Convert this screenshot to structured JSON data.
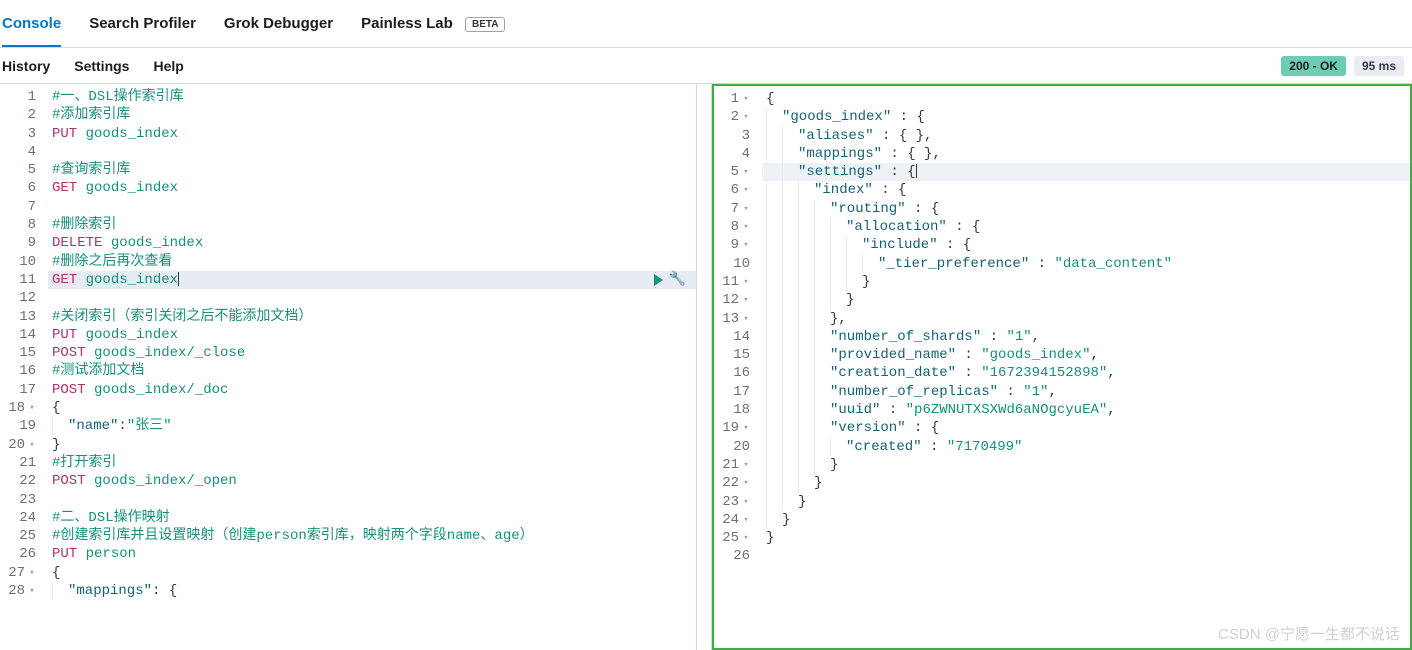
{
  "tabs": {
    "console": "Console",
    "profiler": "Search Profiler",
    "grok": "Grok Debugger",
    "painless": "Painless Lab",
    "beta": "BETA"
  },
  "menu": {
    "history": "History",
    "settings": "Settings",
    "help": "Help"
  },
  "status": {
    "ok": "200 - OK",
    "time": "95 ms"
  },
  "editor": {
    "lines": [
      {
        "n": 1,
        "type": "comment",
        "text": "#一、DSL操作索引库"
      },
      {
        "n": 2,
        "type": "comment",
        "text": "#添加索引库"
      },
      {
        "n": 3,
        "type": "req",
        "method": "PUT",
        "path": " goods_index"
      },
      {
        "n": 4,
        "type": "blank",
        "text": ""
      },
      {
        "n": 5,
        "type": "comment",
        "text": "#查询索引库"
      },
      {
        "n": 6,
        "type": "req",
        "method": "GET",
        "path": " goods_index"
      },
      {
        "n": 7,
        "type": "blank",
        "text": ""
      },
      {
        "n": 8,
        "type": "comment",
        "text": "#删除索引"
      },
      {
        "n": 9,
        "type": "req",
        "method": "DELETE",
        "path": " goods_index"
      },
      {
        "n": 10,
        "type": "comment",
        "text": "#删除之后再次查看"
      },
      {
        "n": 11,
        "type": "req",
        "method": "GET",
        "path": " goods_index",
        "hl": true,
        "actions": true,
        "cursor": true
      },
      {
        "n": 12,
        "type": "blank",
        "text": ""
      },
      {
        "n": 13,
        "type": "comment",
        "text": "#关闭索引（索引关闭之后不能添加文档）"
      },
      {
        "n": 14,
        "type": "req",
        "method": "PUT",
        "path": " goods_index"
      },
      {
        "n": 15,
        "type": "req",
        "method": "POST",
        "path": " goods_index/_close"
      },
      {
        "n": 16,
        "type": "comment",
        "text": "#测试添加文档"
      },
      {
        "n": 17,
        "type": "req",
        "method": "POST",
        "path": " goods_index/_doc"
      },
      {
        "n": 18,
        "type": "punct",
        "text": "{",
        "fold": true
      },
      {
        "n": 19,
        "type": "kv",
        "indent": 1,
        "key": "\"name\"",
        "sep": ":",
        "val": "\"张三\""
      },
      {
        "n": 20,
        "type": "punct",
        "text": "}",
        "fold": true
      },
      {
        "n": 21,
        "type": "comment",
        "text": "#打开索引"
      },
      {
        "n": 22,
        "type": "req",
        "method": "POST",
        "path": " goods_index/_open"
      },
      {
        "n": 23,
        "type": "blank",
        "text": ""
      },
      {
        "n": 24,
        "type": "comment",
        "text": "#二、DSL操作映射"
      },
      {
        "n": 25,
        "type": "comment",
        "text": "#创建索引库并且设置映射（创建person索引库，映射两个字段name、age）"
      },
      {
        "n": 26,
        "type": "req",
        "method": "PUT",
        "path": " person"
      },
      {
        "n": 27,
        "type": "punct",
        "text": "{",
        "fold": true
      },
      {
        "n": 28,
        "type": "kv",
        "indent": 1,
        "key": "\"mappings\"",
        "sep": ": ",
        "val": "{",
        "fold": true
      }
    ]
  },
  "response": {
    "lines": [
      {
        "n": 1,
        "fold": true,
        "ind": 0,
        "seg": [
          {
            "t": "{",
            "c": "punct"
          }
        ]
      },
      {
        "n": 2,
        "fold": true,
        "ind": 1,
        "seg": [
          {
            "t": "\"goods_index\"",
            "c": "key"
          },
          {
            "t": " : ",
            "c": "punct"
          },
          {
            "t": "{",
            "c": "punct"
          }
        ]
      },
      {
        "n": 3,
        "fold": false,
        "ind": 2,
        "seg": [
          {
            "t": "\"aliases\"",
            "c": "key"
          },
          {
            "t": " : ",
            "c": "punct"
          },
          {
            "t": "{ },",
            "c": "punct"
          }
        ]
      },
      {
        "n": 4,
        "fold": false,
        "ind": 2,
        "seg": [
          {
            "t": "\"mappings\"",
            "c": "key"
          },
          {
            "t": " : ",
            "c": "punct"
          },
          {
            "t": "{ },",
            "c": "punct"
          }
        ]
      },
      {
        "n": 5,
        "fold": true,
        "ind": 2,
        "hl": true,
        "seg": [
          {
            "t": "\"settings\"",
            "c": "key"
          },
          {
            "t": " : ",
            "c": "punct"
          },
          {
            "t": "{",
            "c": "punct"
          }
        ],
        "cursor": true
      },
      {
        "n": 6,
        "fold": true,
        "ind": 3,
        "seg": [
          {
            "t": "\"index\"",
            "c": "key"
          },
          {
            "t": " : ",
            "c": "punct"
          },
          {
            "t": "{",
            "c": "punct"
          }
        ]
      },
      {
        "n": 7,
        "fold": true,
        "ind": 4,
        "seg": [
          {
            "t": "\"routing\"",
            "c": "key"
          },
          {
            "t": " : ",
            "c": "punct"
          },
          {
            "t": "{",
            "c": "punct"
          }
        ]
      },
      {
        "n": 8,
        "fold": true,
        "ind": 5,
        "seg": [
          {
            "t": "\"allocation\"",
            "c": "key"
          },
          {
            "t": " : ",
            "c": "punct"
          },
          {
            "t": "{",
            "c": "punct"
          }
        ]
      },
      {
        "n": 9,
        "fold": true,
        "ind": 6,
        "seg": [
          {
            "t": "\"include\"",
            "c": "key"
          },
          {
            "t": " : ",
            "c": "punct"
          },
          {
            "t": "{",
            "c": "punct"
          }
        ]
      },
      {
        "n": 10,
        "fold": false,
        "ind": 7,
        "seg": [
          {
            "t": "\"_tier_preference\"",
            "c": "key"
          },
          {
            "t": " : ",
            "c": "punct"
          },
          {
            "t": "\"data_content\"",
            "c": "string"
          }
        ]
      },
      {
        "n": 11,
        "fold": true,
        "ind": 6,
        "seg": [
          {
            "t": "}",
            "c": "punct"
          }
        ]
      },
      {
        "n": 12,
        "fold": true,
        "ind": 5,
        "seg": [
          {
            "t": "}",
            "c": "punct"
          }
        ]
      },
      {
        "n": 13,
        "fold": true,
        "ind": 4,
        "seg": [
          {
            "t": "},",
            "c": "punct"
          }
        ]
      },
      {
        "n": 14,
        "fold": false,
        "ind": 4,
        "seg": [
          {
            "t": "\"number_of_shards\"",
            "c": "key"
          },
          {
            "t": " : ",
            "c": "punct"
          },
          {
            "t": "\"1\"",
            "c": "string"
          },
          {
            "t": ",",
            "c": "punct"
          }
        ]
      },
      {
        "n": 15,
        "fold": false,
        "ind": 4,
        "seg": [
          {
            "t": "\"provided_name\"",
            "c": "key"
          },
          {
            "t": " : ",
            "c": "punct"
          },
          {
            "t": "\"goods_index\"",
            "c": "string"
          },
          {
            "t": ",",
            "c": "punct"
          }
        ]
      },
      {
        "n": 16,
        "fold": false,
        "ind": 4,
        "seg": [
          {
            "t": "\"creation_date\"",
            "c": "key"
          },
          {
            "t": " : ",
            "c": "punct"
          },
          {
            "t": "\"1672394152898\"",
            "c": "string"
          },
          {
            "t": ",",
            "c": "punct"
          }
        ]
      },
      {
        "n": 17,
        "fold": false,
        "ind": 4,
        "seg": [
          {
            "t": "\"number_of_replicas\"",
            "c": "key"
          },
          {
            "t": " : ",
            "c": "punct"
          },
          {
            "t": "\"1\"",
            "c": "string"
          },
          {
            "t": ",",
            "c": "punct"
          }
        ]
      },
      {
        "n": 18,
        "fold": false,
        "ind": 4,
        "seg": [
          {
            "t": "\"uuid\"",
            "c": "key"
          },
          {
            "t": " : ",
            "c": "punct"
          },
          {
            "t": "\"p6ZWNUTXSXWd6aNOgcyuEA\"",
            "c": "string"
          },
          {
            "t": ",",
            "c": "punct"
          }
        ]
      },
      {
        "n": 19,
        "fold": true,
        "ind": 4,
        "seg": [
          {
            "t": "\"version\"",
            "c": "key"
          },
          {
            "t": " : ",
            "c": "punct"
          },
          {
            "t": "{",
            "c": "punct"
          }
        ]
      },
      {
        "n": 20,
        "fold": false,
        "ind": 5,
        "seg": [
          {
            "t": "\"created\"",
            "c": "key"
          },
          {
            "t": " : ",
            "c": "punct"
          },
          {
            "t": "\"7170499\"",
            "c": "string"
          }
        ]
      },
      {
        "n": 21,
        "fold": true,
        "ind": 4,
        "seg": [
          {
            "t": "}",
            "c": "punct"
          }
        ]
      },
      {
        "n": 22,
        "fold": true,
        "ind": 3,
        "seg": [
          {
            "t": "}",
            "c": "punct"
          }
        ]
      },
      {
        "n": 23,
        "fold": true,
        "ind": 2,
        "seg": [
          {
            "t": "}",
            "c": "punct"
          }
        ]
      },
      {
        "n": 24,
        "fold": true,
        "ind": 1,
        "seg": [
          {
            "t": "}",
            "c": "punct"
          }
        ]
      },
      {
        "n": 25,
        "fold": true,
        "ind": 0,
        "seg": [
          {
            "t": "}",
            "c": "punct"
          }
        ]
      },
      {
        "n": 26,
        "fold": false,
        "ind": 0,
        "seg": []
      }
    ]
  },
  "watermark": "CSDN @宁愿一生都不说话"
}
